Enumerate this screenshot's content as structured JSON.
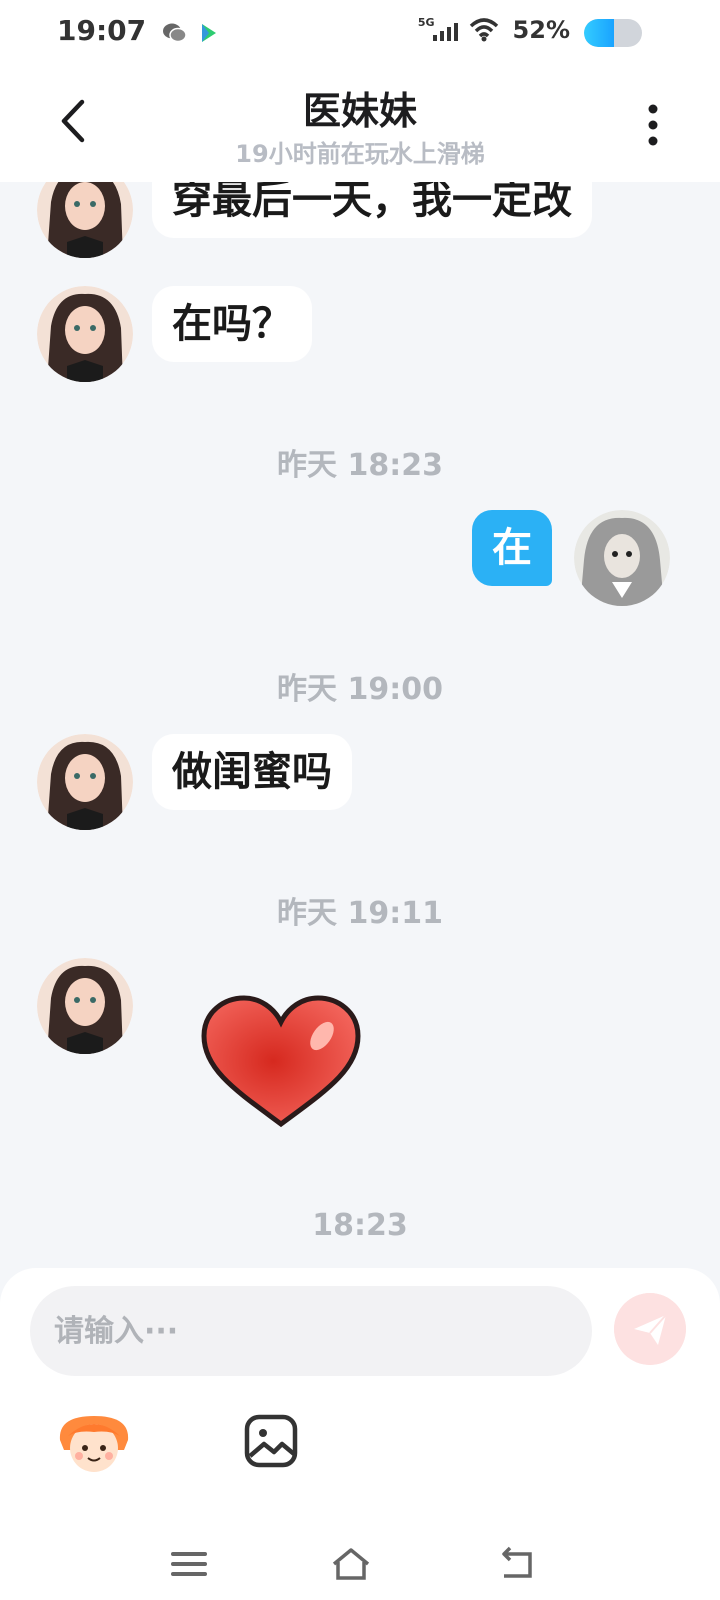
{
  "status_bar": {
    "time": "19:07",
    "app_icons": [
      "wechat-icon",
      "app-store-icon"
    ],
    "network_label": "5G",
    "battery_percent_text": "52%",
    "battery_level": 0.52
  },
  "header": {
    "title": "医妹妹",
    "subtitle": "19小时前在玩水上滑梯"
  },
  "messages": [
    {
      "type": "text",
      "from": "contact",
      "text": "穿最后一天，我一定改"
    },
    {
      "type": "text",
      "from": "contact",
      "text": "在吗？"
    },
    {
      "type": "time",
      "text": "昨天 18:23"
    },
    {
      "type": "text",
      "from": "self",
      "text": "在"
    },
    {
      "type": "time",
      "text": "昨天 19:00"
    },
    {
      "type": "text",
      "from": "contact",
      "text": "做闺蜜吗"
    },
    {
      "type": "time",
      "text": "昨天 19:11"
    },
    {
      "type": "sticker",
      "from": "contact",
      "sticker": "red-heart"
    },
    {
      "type": "time",
      "text": "18:23"
    }
  ],
  "composer": {
    "placeholder": "请输入···",
    "value": ""
  },
  "colors": {
    "accent_blue": "#2bb1f5",
    "background": "#f4f6f9",
    "send_button_disabled": "#fde1e1"
  }
}
